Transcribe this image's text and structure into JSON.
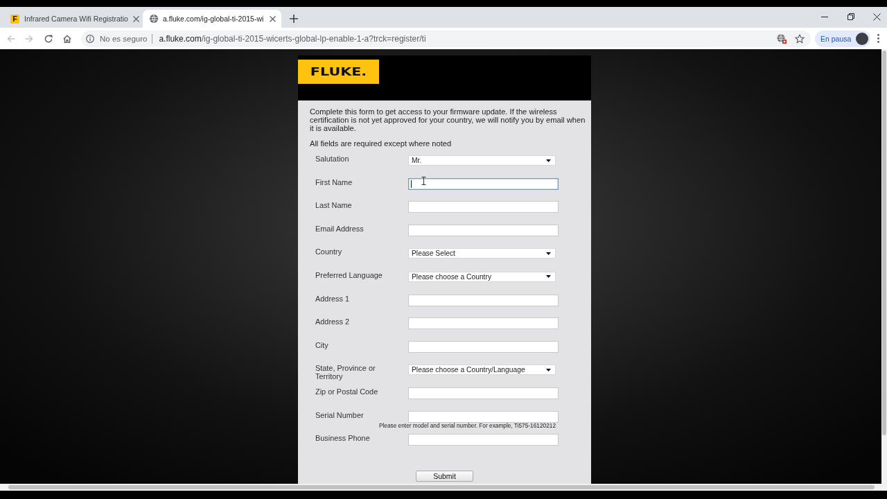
{
  "browser": {
    "tabs": [
      {
        "title": "Infrared Camera Wifi Registratio",
        "favicon": "F",
        "selected": false
      },
      {
        "title": "a.fluke.com/ig-global-ti-2015-wi",
        "selected": true
      }
    ],
    "toolbar": {
      "back": {
        "disabled": true
      },
      "forward": {
        "disabled": true
      }
    },
    "address_bar": {
      "security_label": "No es seguro",
      "url_host": "a.fluke.com",
      "url_path": "/ig-global-ti-2015-wicerts-global-lp-enable-1-a?trck=register/ti"
    },
    "profile": {
      "label": "En pausa"
    }
  },
  "page": {
    "logo": "FLUKE.",
    "intro": "Complete this form to get access to your firmware update. If the wireless certification is not yet approved for your country, we will notify you by email when it is available.",
    "note": "All fields are required except where noted",
    "fields": [
      {
        "label": "Salutation",
        "kind": "select",
        "value": "Mr.",
        "focused": false
      },
      {
        "label": "First Name",
        "kind": "text",
        "focused": true
      },
      {
        "label": "Last Name",
        "kind": "text",
        "focused": false
      },
      {
        "label": "Email Address",
        "kind": "text",
        "focused": false
      },
      {
        "label": "Country",
        "kind": "select",
        "value": "Please Select",
        "focused": false
      },
      {
        "label": "Preferred Language",
        "kind": "select",
        "value": "Please choose a Country",
        "focused": false
      },
      {
        "label": "Address 1",
        "kind": "text",
        "focused": false
      },
      {
        "label": "Address 2",
        "kind": "text",
        "focused": false
      },
      {
        "label": "City",
        "kind": "text",
        "focused": false
      },
      {
        "label": "State, Province or Territory",
        "kind": "select",
        "value": "Please choose a Country/Language",
        "focused": false
      },
      {
        "label": "Zip or Postal Code",
        "kind": "text",
        "focused": false
      },
      {
        "label": "Serial Number",
        "kind": "text",
        "focused": false,
        "hint": "Please enter model and serial number. For example, Ti575-16120212"
      },
      {
        "label": "Business Phone",
        "kind": "text",
        "focused": false
      }
    ],
    "submit": "Submit"
  }
}
